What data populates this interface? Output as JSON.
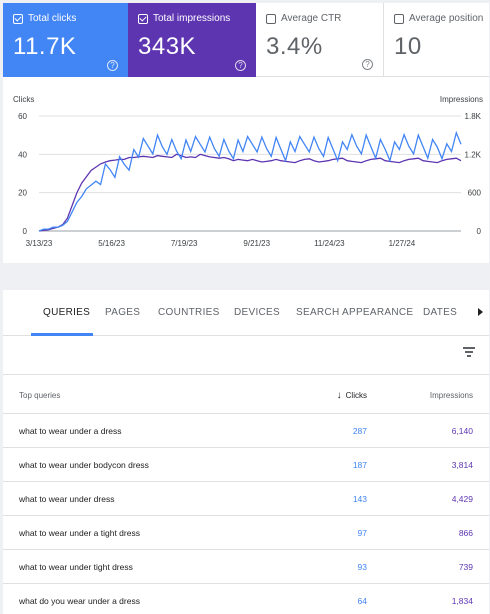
{
  "metrics": [
    {
      "label": "Total clicks",
      "value": "11.7K",
      "checked": true
    },
    {
      "label": "Total impressions",
      "value": "343K",
      "checked": true
    },
    {
      "label": "Average CTR",
      "value": "3.4%",
      "checked": false
    },
    {
      "label": "Average position",
      "value": "10",
      "checked": false
    }
  ],
  "colors": {
    "clicks": "#4285f4",
    "impressions": "#5e35b1"
  },
  "chart_data": {
    "type": "line",
    "left_axis_title": "Clicks",
    "right_axis_title": "Impressions",
    "left_ticks": [
      "60",
      "40",
      "20",
      "0"
    ],
    "right_ticks": [
      "1.8K",
      "1.2K",
      "600",
      "0"
    ],
    "x_ticks": [
      "3/13/23",
      "5/16/23",
      "7/19/23",
      "9/21/23",
      "11/24/23",
      "1/27/24"
    ],
    "ylim_left": [
      0,
      60
    ],
    "ylim_right": [
      0,
      1800
    ],
    "grid": true,
    "series": [
      {
        "name": "Clicks",
        "axis": "left",
        "values": [
          0,
          1,
          1,
          2,
          2,
          3,
          5,
          10,
          15,
          18,
          22,
          24,
          26,
          28,
          30,
          32,
          33,
          35,
          36,
          38,
          40,
          41,
          42,
          43,
          44,
          45,
          44,
          45,
          44,
          43,
          44,
          45,
          44,
          43,
          44,
          45,
          44,
          43,
          44,
          44,
          43,
          44,
          45,
          44,
          43,
          44,
          45,
          44,
          43,
          44,
          45,
          44,
          43,
          44,
          44,
          43,
          44,
          45,
          44,
          43,
          44,
          45,
          44,
          43,
          44,
          45,
          44,
          43,
          44,
          45,
          44,
          43,
          44,
          44,
          43,
          44,
          45,
          44,
          43,
          44,
          45,
          44,
          43,
          44,
          45,
          44,
          43,
          44,
          45,
          44
        ]
      },
      {
        "name": "Impressions",
        "axis": "right",
        "values": [
          0,
          10,
          20,
          40,
          60,
          100,
          200,
          400,
          600,
          750,
          850,
          950,
          1000,
          1050,
          1080,
          1100,
          1110,
          1120,
          1120,
          1150,
          1150,
          1160,
          1170,
          1160,
          1150,
          1180,
          1170,
          1160,
          1150,
          1200,
          1180,
          1150,
          1160,
          1150,
          1200,
          1180,
          1160,
          1150,
          1140,
          1150,
          1130,
          1100,
          1120,
          1110,
          1100,
          1120,
          1100,
          1080,
          1090,
          1100,
          1120,
          1100,
          1090,
          1080,
          1070,
          1100,
          1120,
          1130,
          1100,
          1080,
          1090,
          1100,
          1120,
          1130,
          1140,
          1100,
          1090,
          1080,
          1070,
          1100,
          1120,
          1130,
          1140,
          1100,
          1090,
          1080,
          1070,
          1100,
          1120,
          1130,
          1140,
          1100,
          1090,
          1080,
          1070,
          1100,
          1120,
          1130,
          1140,
          1100
        ]
      }
    ]
  },
  "tabs": [
    "QUERIES",
    "PAGES",
    "COUNTRIES",
    "DEVICES",
    "SEARCH APPEARANCE",
    "DATES"
  ],
  "table": {
    "headers": {
      "query": "Top queries",
      "clicks": "Clicks",
      "impressions": "Impressions"
    },
    "rows": [
      {
        "query": "what to wear under a dress",
        "clicks": "287",
        "impressions": "6,140"
      },
      {
        "query": "what to wear under bodycon dress",
        "clicks": "187",
        "impressions": "3,814"
      },
      {
        "query": "what to wear under dress",
        "clicks": "143",
        "impressions": "4,429"
      },
      {
        "query": "what to wear under a tight dress",
        "clicks": "97",
        "impressions": "866"
      },
      {
        "query": "what to wear under tight dress",
        "clicks": "93",
        "impressions": "739"
      },
      {
        "query": "what do you wear under a dress",
        "clicks": "64",
        "impressions": "1,834"
      }
    ]
  }
}
